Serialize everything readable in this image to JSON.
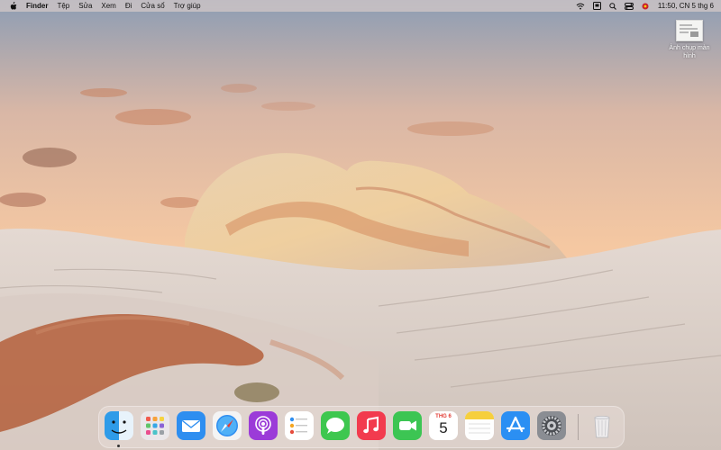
{
  "menubar": {
    "app_name": "Finder",
    "items": [
      "Tệp",
      "Sửa",
      "Xem",
      "Đi",
      "Cửa sổ",
      "Trợ giúp"
    ],
    "clock": "11:50, CN 5 thg 6",
    "status_icons": [
      "wifi-icon",
      "hanging-display-icon",
      "search-icon",
      "control-center-icon",
      "flag-icon"
    ]
  },
  "desktop": {
    "screenshot_label": "Ảnh chụp màn hình"
  },
  "dock": {
    "apps": [
      "Finder",
      "Launchpad",
      "Mail",
      "Safari",
      "Podcasts",
      "Reminders",
      "Messages",
      "Music",
      "FaceTime",
      "Calendar",
      "Notes",
      "App Store",
      "System Preferences",
      "Trash"
    ],
    "calendar_month": "THG 6",
    "calendar_day": "5"
  },
  "colors": {
    "sky_top": "#8f9fb6",
    "sky_bottom": "#f5c9a3",
    "rock": "#e2d6cd",
    "red_sand": "#b2603c"
  }
}
